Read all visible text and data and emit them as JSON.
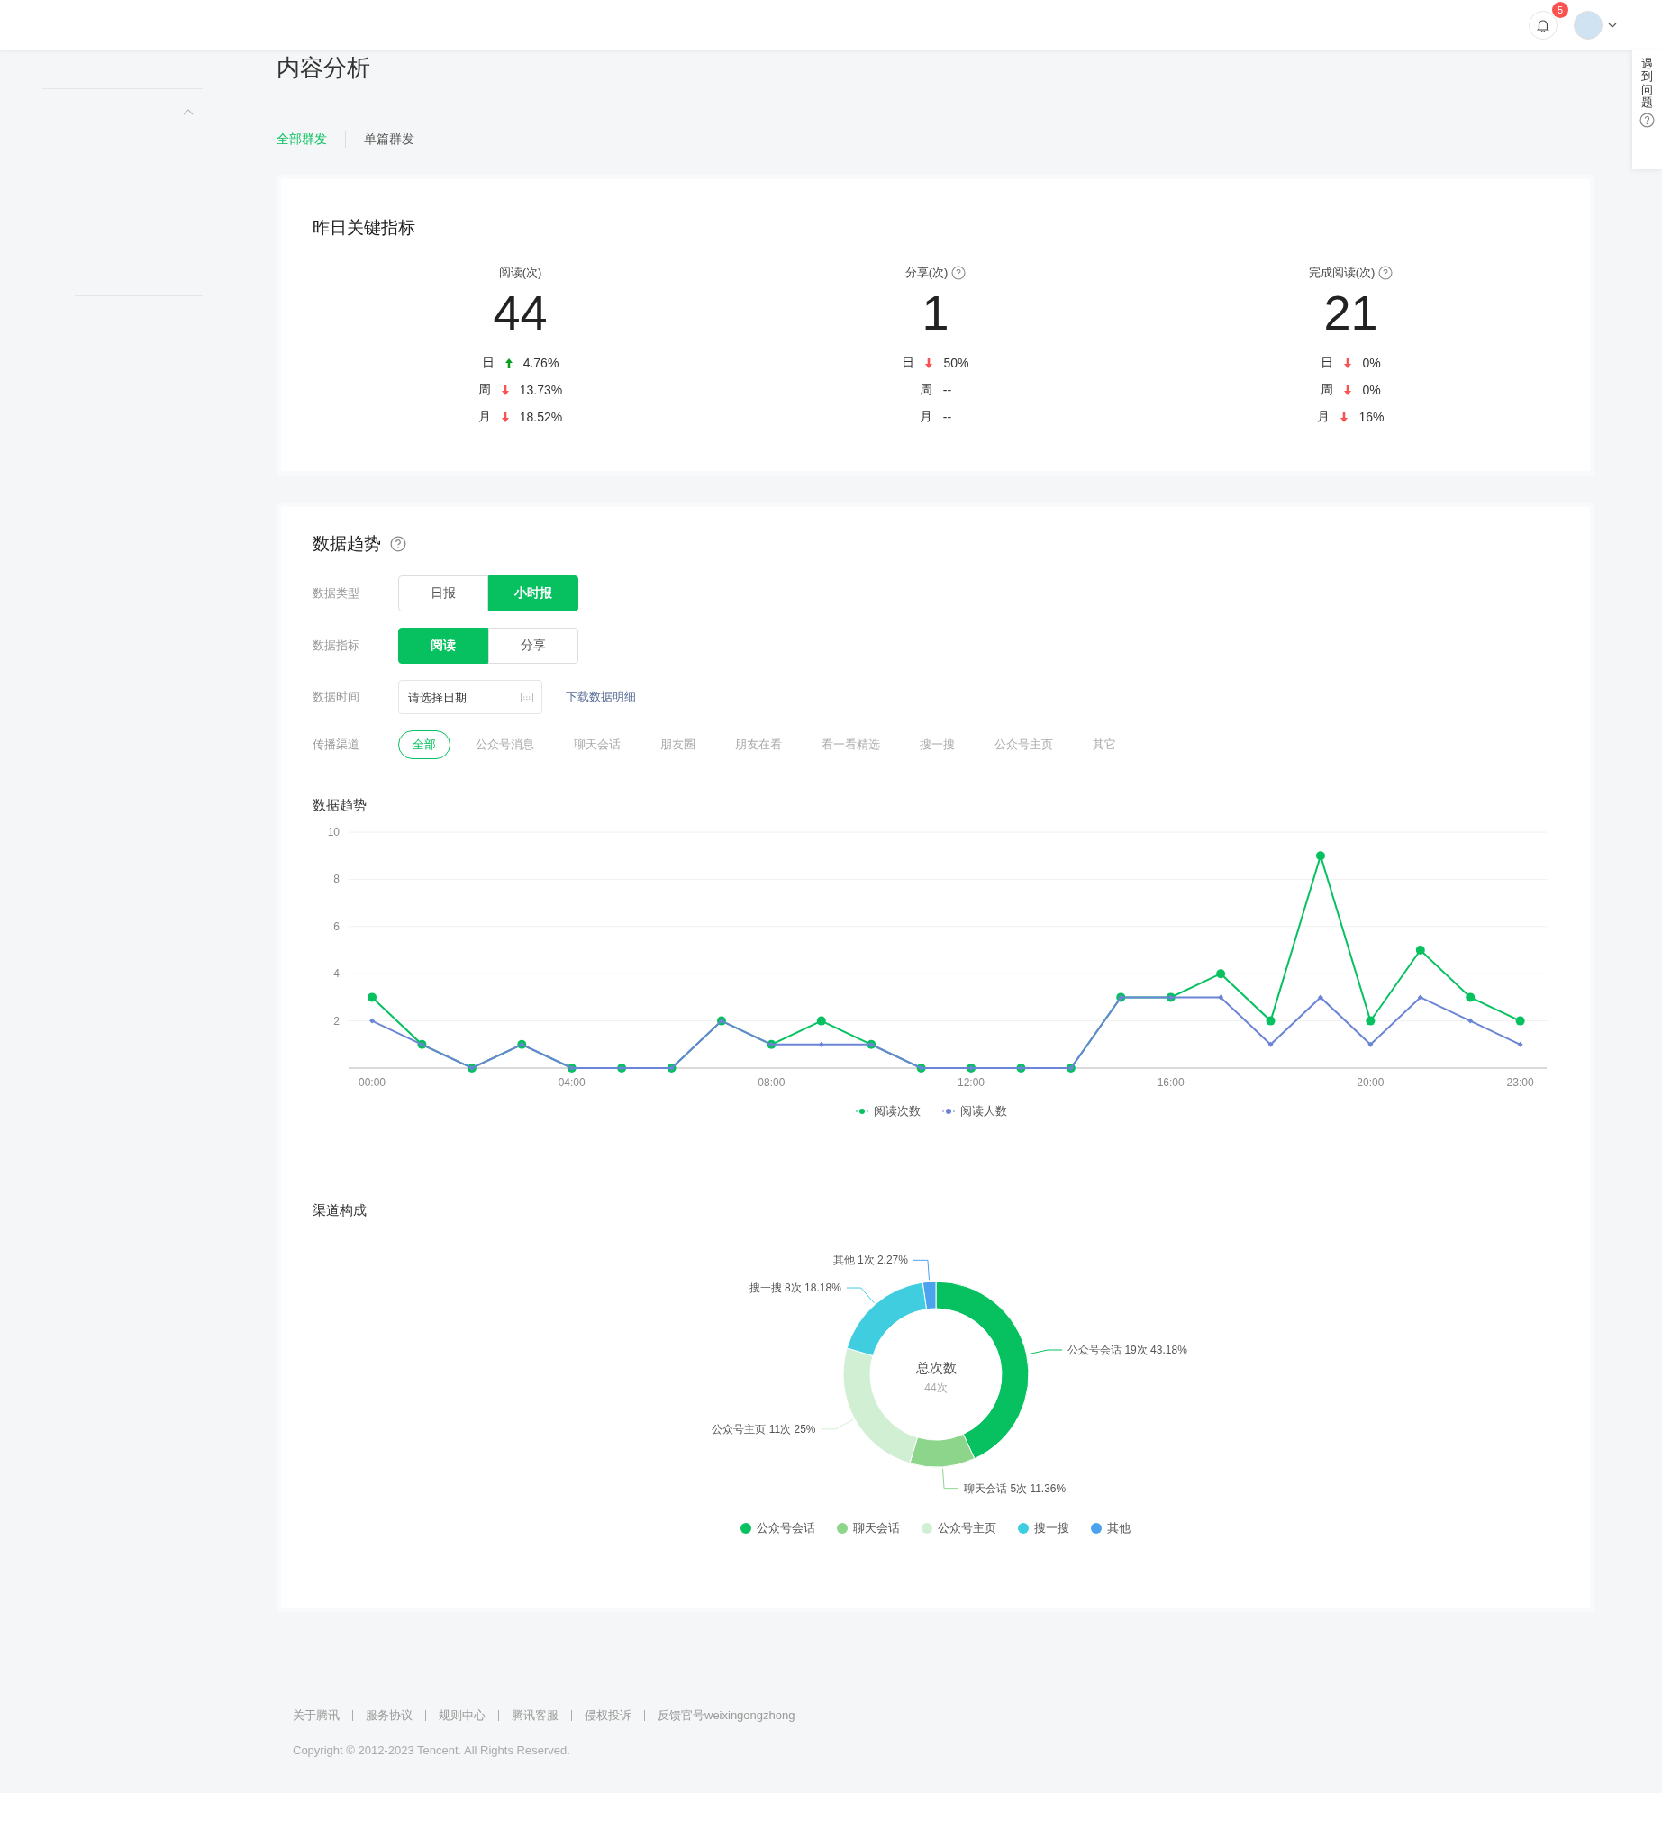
{
  "header": {
    "notification_count": "5"
  },
  "help_tab": {
    "label": "遇到问题"
  },
  "page": {
    "title": "内容分析"
  },
  "tabs": [
    {
      "label": "全部群发",
      "selected": true
    },
    {
      "label": "单篇群发",
      "selected": false
    }
  ],
  "key_metrics": {
    "title": "昨日关键指标",
    "metrics": [
      {
        "label": "阅读(次)",
        "has_help": false,
        "value": "44",
        "rows": [
          {
            "period": "日",
            "kind": "up",
            "change": "4.76%"
          },
          {
            "period": "周",
            "kind": "down",
            "change": "13.73%"
          },
          {
            "period": "月",
            "kind": "down",
            "change": "18.52%"
          }
        ]
      },
      {
        "label": "分享(次)",
        "has_help": true,
        "value": "1",
        "rows": [
          {
            "period": "日",
            "kind": "down",
            "change": "50%"
          },
          {
            "period": "周",
            "kind": "flat",
            "change": "--"
          },
          {
            "period": "月",
            "kind": "flat",
            "change": "--"
          }
        ]
      },
      {
        "label": "完成阅读(次)",
        "has_help": true,
        "value": "21",
        "rows": [
          {
            "period": "日",
            "kind": "down",
            "change": "0%"
          },
          {
            "period": "周",
            "kind": "down",
            "change": "0%"
          },
          {
            "period": "月",
            "kind": "down",
            "change": "16%"
          }
        ]
      }
    ]
  },
  "trend": {
    "title": "数据趋势",
    "data_type": {
      "label": "数据类型",
      "options": [
        {
          "label": "日报",
          "selected": false
        },
        {
          "label": "小时报",
          "selected": true
        }
      ]
    },
    "data_metric": {
      "label": "数据指标",
      "options": [
        {
          "label": "阅读",
          "selected": true
        },
        {
          "label": "分享",
          "selected": false
        }
      ]
    },
    "data_time": {
      "label": "数据时间",
      "placeholder": "请选择日期",
      "download_link": "下载数据明细"
    },
    "channels": {
      "label": "传播渠道",
      "options": [
        {
          "label": "全部",
          "selected": true
        },
        {
          "label": "公众号消息",
          "selected": false
        },
        {
          "label": "聊天会话",
          "selected": false
        },
        {
          "label": "朋友圈",
          "selected": false
        },
        {
          "label": "朋友在看",
          "selected": false
        },
        {
          "label": "看一看精选",
          "selected": false
        },
        {
          "label": "搜一搜",
          "selected": false
        },
        {
          "label": "公众号主页",
          "selected": false
        },
        {
          "label": "其它",
          "selected": false
        }
      ]
    },
    "line_chart": {
      "chart_data": {
        "type": "line",
        "title": "数据趋势",
        "x": [
          0,
          1,
          2,
          3,
          4,
          5,
          6,
          7,
          8,
          9,
          10,
          11,
          12,
          13,
          14,
          15,
          16,
          17,
          18,
          19,
          20,
          21,
          22,
          23
        ],
        "xlim": [
          -0.47,
          23.53
        ],
        "grid": true,
        "legend": "bottom",
        "xticks": [
          {
            "value": 0,
            "label": "00:00"
          },
          {
            "value": 4,
            "label": "04:00"
          },
          {
            "value": 8,
            "label": "08:00"
          },
          {
            "value": 12,
            "label": "12:00"
          },
          {
            "value": 16,
            "label": "16:00"
          },
          {
            "value": 20,
            "label": "20:00"
          },
          {
            "value": 23,
            "label": "23:00"
          }
        ],
        "ylim": [
          0,
          10
        ],
        "yticks": [
          2,
          4,
          6,
          8,
          10
        ],
        "series": [
          {
            "name": "阅读次数",
            "color": "#07c160",
            "marker": "circle",
            "values": [
              3,
              1,
              0,
              1,
              0,
              0,
              0,
              2,
              1,
              2,
              1,
              0,
              0,
              0,
              0,
              3,
              3,
              4,
              2,
              9,
              2,
              5,
              3,
              2
            ]
          },
          {
            "name": "阅读人数",
            "color": "#6b85d6",
            "marker": "diamond",
            "values": [
              2,
              1,
              0,
              1,
              0,
              0,
              0,
              2,
              1,
              1,
              1,
              0,
              0,
              0,
              0,
              3,
              3,
              3,
              1,
              3,
              1,
              3,
              2,
              1
            ]
          }
        ]
      }
    },
    "donut": {
      "chart_data": {
        "type": "donut",
        "title": "渠道构成",
        "categories": [
          "公众号会话",
          "聊天会话",
          "公众号主页",
          "搜一搜",
          "其他"
        ],
        "values": [
          19,
          5,
          11,
          8,
          1
        ],
        "legend": "bottom",
        "colors": [
          "#07c160",
          "#8cd58b",
          "#d1efd2",
          "#40cde0",
          "#4aa3ec"
        ],
        "value_labels": [
          "公众号会话 19次 43.18%",
          "聊天会话 5次 11.36%",
          "公众号主页 11次 25%",
          "搜一搜 8次 18.18%",
          "其他 1次 2.27%"
        ]
      },
      "center_label": "总次数",
      "center_value": "44次"
    }
  },
  "footer": {
    "links": [
      "关于腾讯",
      "服务协议",
      "规则中心",
      "腾讯客服",
      "侵权投诉",
      "反馈官号weixingongzhong"
    ],
    "copyright": "Copyright © 2012-2023 Tencent. All Rights Reserved."
  }
}
